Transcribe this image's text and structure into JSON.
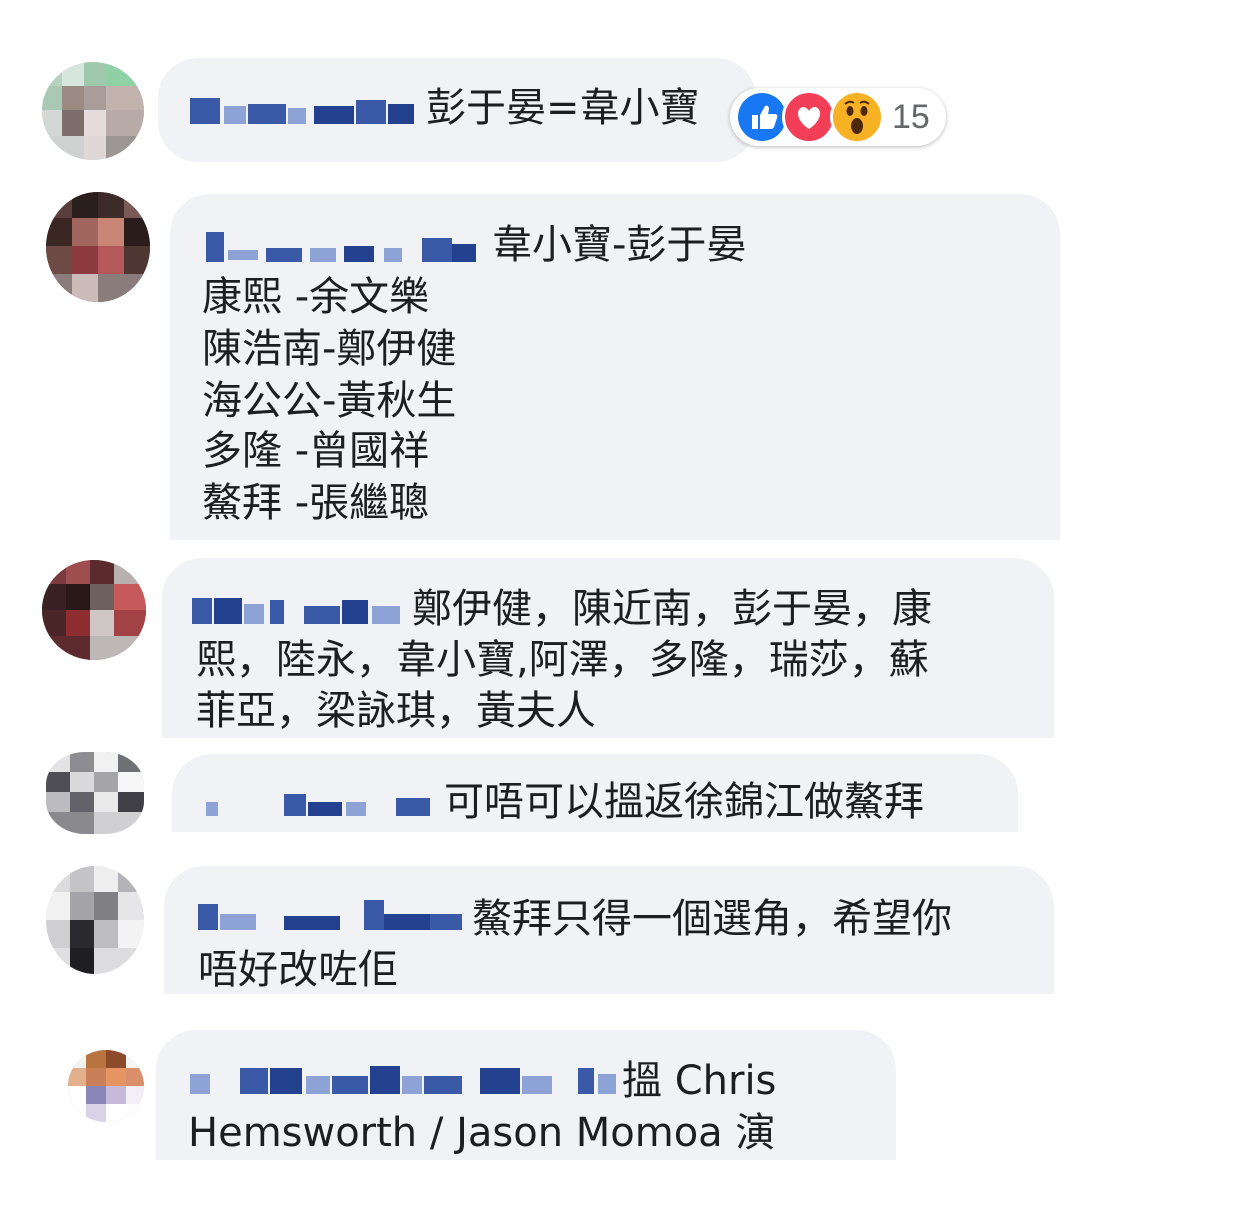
{
  "comments": [
    {
      "name_redacted": true,
      "text": "彭于晏=韋小寶",
      "reactions": {
        "icons": [
          "like-icon",
          "love-icon",
          "wow-icon"
        ],
        "count": "15"
      }
    },
    {
      "name_redacted": true,
      "lines": [
        "韋小寶-彭于晏",
        "康熙 -余文樂",
        "陳浩南-鄭伊健",
        "海公公-黃秋生",
        "多隆 -曾國祥",
        "鰲拜 -張繼聰"
      ]
    },
    {
      "name_redacted": true,
      "lines": [
        "鄭伊健，陳近南，彭于晏，康",
        "熙，陸永，韋小寶,阿澤，多隆，瑞莎，蘇",
        "菲亞，梁詠琪，黃夫人"
      ]
    },
    {
      "name_redacted": true,
      "text": "可唔可以搵返徐錦江做鰲拜"
    },
    {
      "name_redacted": true,
      "lines": [
        "鰲拜只得一個選角，希望你",
        "唔好改咗佢"
      ]
    },
    {
      "name_redacted": true,
      "lines": [
        "搵 Chris",
        "Hemsworth / Jason Momoa 演"
      ]
    }
  ],
  "colors": {
    "bubble": "#f0f2f5",
    "name_link": "#3a5aa8",
    "like": "#1877f2",
    "love": "#f33e58",
    "wow": "#f7b125"
  }
}
